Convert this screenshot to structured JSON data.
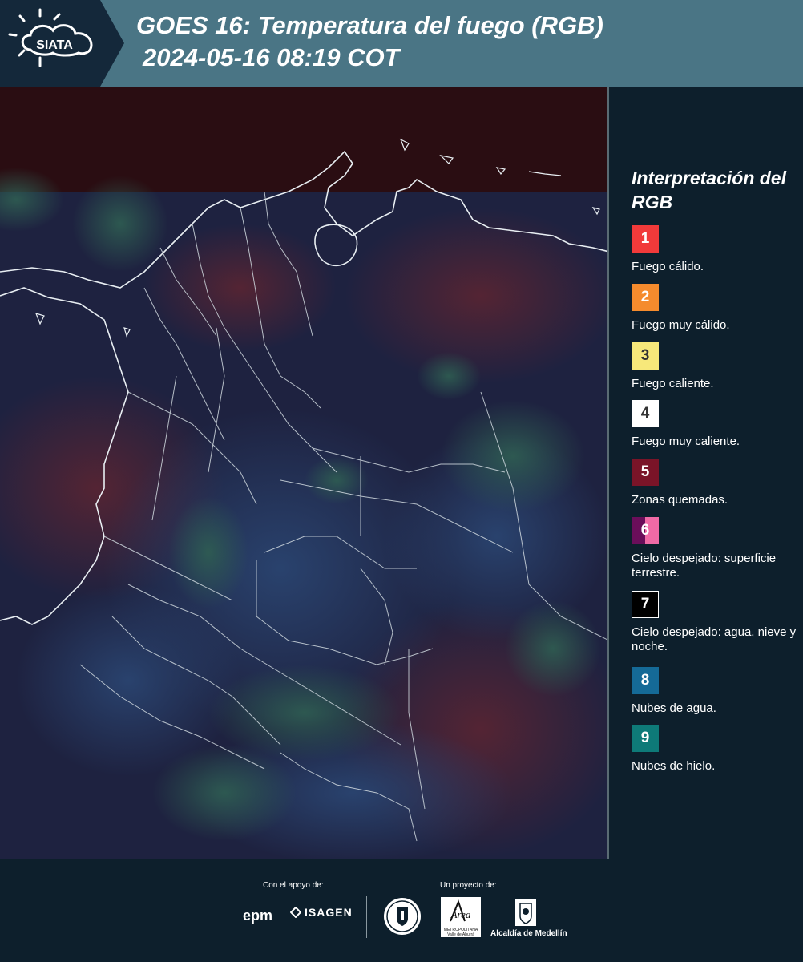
{
  "header": {
    "logo_text": "SIATA",
    "title_line1": "GOES 16: Temperatura del fuego (RGB)",
    "title_line2": "2024-05-16 08:19 COT"
  },
  "legend": {
    "title": "Interpretación del RGB",
    "items": [
      {
        "number": "1",
        "label": "Fuego cálido.",
        "color": "#f13a3a"
      },
      {
        "number": "2",
        "label": "Fuego muy cálido.",
        "color": "#f58b2d"
      },
      {
        "number": "3",
        "label": "Fuego caliente.",
        "color": "#f7e87a"
      },
      {
        "number": "4",
        "label": "Fuego muy caliente.",
        "color": "#ffffff"
      },
      {
        "number": "5",
        "label": "Zonas quemadas.",
        "color": "#7a1428"
      },
      {
        "number": "6",
        "label": "Cielo despejado: superficie terrestre.",
        "color": "#6a0e5a",
        "color2": "#f06aa6"
      },
      {
        "number": "7",
        "label": "Cielo despejado: agua, nieve y noche.",
        "color": "#000000"
      },
      {
        "number": "8",
        "label": "Nubes de agua.",
        "color": "#156a97"
      },
      {
        "number": "9",
        "label": "Nubes de hielo.",
        "color": "#0e7a78"
      }
    ]
  },
  "footer": {
    "support_label": "Con el apoyo de:",
    "project_label": "Un proyecto de:",
    "sponsor1": "epm",
    "sponsor2": "ISAGEN",
    "partner_amva": "Área",
    "partner_amva_sub": "METROPOLITANA Valle de Aburrá",
    "partner_alcaldia": "Alcaldía de Medellín"
  }
}
